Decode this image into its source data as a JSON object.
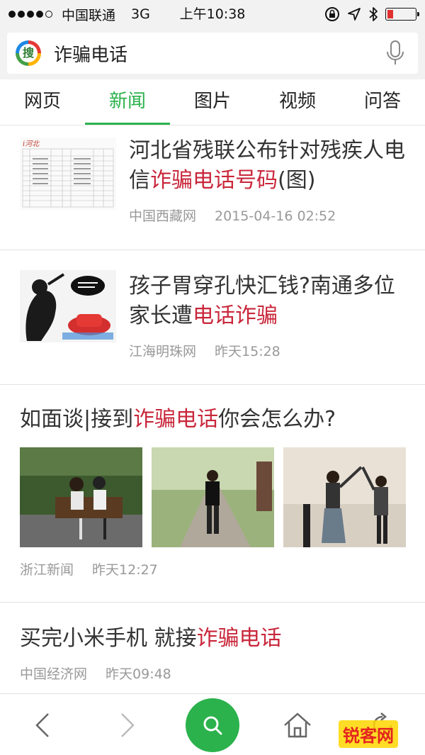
{
  "status_bar": {
    "carrier": "中国联通",
    "network": "3G",
    "time": "上午10:38",
    "signal_bars": 4,
    "signal_max": 5
  },
  "search": {
    "logo_text": "搜",
    "query": "诈骗电话"
  },
  "tabs": [
    {
      "label": "网页"
    },
    {
      "label": "新闻"
    },
    {
      "label": "图片"
    },
    {
      "label": "视频"
    },
    {
      "label": "问答"
    }
  ],
  "active_tab": "新闻",
  "feed": [
    {
      "title_before": "河北省残联公布针对残疾人电信",
      "title_highlight": "诈骗电话号码",
      "title_after": "(图)",
      "source": "中国西藏网",
      "time": "2015-04-16 02:52"
    },
    {
      "title_before": "孩子胃穿孔快汇钱?南通多位家长遭",
      "title_highlight": "电话诈骗",
      "title_after": "",
      "source": "江海明珠网",
      "time": "昨天15:28"
    },
    {
      "title_before": "如面谈|接到",
      "title_highlight": "诈骗电话",
      "title_after": "你会怎么办?",
      "source": "浙江新闻",
      "time": "昨天12:27"
    },
    {
      "title_before": "买完小米手机 就接",
      "title_highlight": "诈骗电话",
      "title_after": "",
      "source": "中国经济网",
      "time": "昨天09:48"
    }
  ],
  "watermark": "锐客网",
  "colors": {
    "accent_green": "#2bb24c",
    "highlight_red": "#c9273b",
    "meta_gray": "#999999"
  }
}
